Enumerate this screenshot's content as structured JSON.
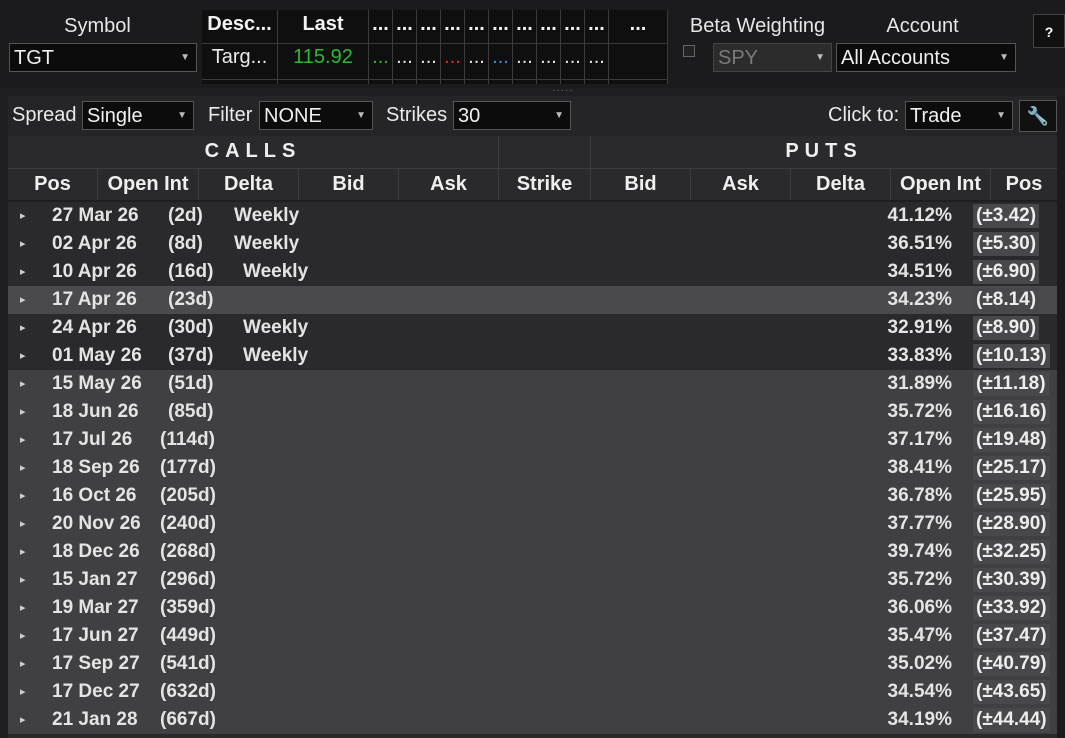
{
  "header": {
    "symbol_label": "Symbol",
    "symbol_value": "TGT",
    "beta_label": "Beta Weighting",
    "beta_value": "SPY",
    "account_label": "Account",
    "account_value": "All Accounts",
    "help": "?"
  },
  "quote": {
    "desc_head": "Desc...",
    "desc_val": "Targ...",
    "last_head": "Last",
    "last_val": "115.92",
    "small_cols": [
      {
        "head": "...",
        "val": "...",
        "color": "#2dbb2d"
      },
      {
        "head": "...",
        "val": "...",
        "color": "#e8e8e8"
      },
      {
        "head": "...",
        "val": "...",
        "color": "#e8e8e8"
      },
      {
        "head": "...",
        "val": "...",
        "color": "#d42a2a"
      },
      {
        "head": "...",
        "val": "...",
        "color": "#e8e8e8"
      },
      {
        "head": "...",
        "val": "...",
        "color": "#3a8fe0"
      },
      {
        "head": "...",
        "val": "...",
        "color": "#e8e8e8"
      },
      {
        "head": "...",
        "val": "...",
        "color": "#e8e8e8"
      },
      {
        "head": "...",
        "val": "...",
        "color": "#e8e8e8"
      },
      {
        "head": "...",
        "val": "...",
        "color": "#e8e8e8"
      },
      {
        "head": "...",
        "val": "",
        "color": "#e8e8e8"
      }
    ],
    "last_color": "#2dbb2d"
  },
  "toolbar": {
    "spread_label": "Spread",
    "spread_value": "Single",
    "filter_label": "Filter",
    "filter_value": "NONE",
    "strikes_label": "Strikes",
    "strikes_value": "30",
    "clickto_label": "Click to:",
    "clickto_value": "Trade"
  },
  "table": {
    "calls_label": "CALLS",
    "puts_label": "PUTS",
    "columns": [
      "Pos",
      "Open Int",
      "Delta",
      "Bid",
      "Ask",
      "Strike",
      "Bid",
      "Ask",
      "Delta",
      "Open Int",
      "Pos"
    ],
    "rows": [
      {
        "date": "27 Mar 26",
        "dte": "(2d)",
        "tag": "Weekly",
        "iv": "41.12%",
        "mm": "(±3.42)"
      },
      {
        "date": "02 Apr 26",
        "dte": "(8d)",
        "tag": "Weekly",
        "iv": "36.51%",
        "mm": "(±5.30)"
      },
      {
        "date": "10 Apr 26",
        "dte": "(16d)",
        "tag": "Weekly",
        "iv": "34.51%",
        "mm": "(±6.90)"
      },
      {
        "date": "17 Apr 26",
        "dte": "(23d)",
        "tag": "",
        "iv": "34.23%",
        "mm": "(±8.14)"
      },
      {
        "date": "24 Apr 26",
        "dte": "(30d)",
        "tag": "Weekly",
        "iv": "32.91%",
        "mm": "(±8.90)"
      },
      {
        "date": "01 May 26",
        "dte": "(37d)",
        "tag": "Weekly",
        "iv": "33.83%",
        "mm": "(±10.13)"
      },
      {
        "date": "15 May 26",
        "dte": "(51d)",
        "tag": "",
        "iv": "31.89%",
        "mm": "(±11.18)"
      },
      {
        "date": "18 Jun 26",
        "dte": "(85d)",
        "tag": "",
        "iv": "35.72%",
        "mm": "(±16.16)"
      },
      {
        "date": "17 Jul 26",
        "dte": "(114d)",
        "tag": "",
        "iv": "37.17%",
        "mm": "(±19.48)"
      },
      {
        "date": "18 Sep 26",
        "dte": "(177d)",
        "tag": "",
        "iv": "38.41%",
        "mm": "(±25.17)"
      },
      {
        "date": "16 Oct 26",
        "dte": "(205d)",
        "tag": "",
        "iv": "36.78%",
        "mm": "(±25.95)"
      },
      {
        "date": "20 Nov 26",
        "dte": "(240d)",
        "tag": "",
        "iv": "37.77%",
        "mm": "(±28.90)"
      },
      {
        "date": "18 Dec 26",
        "dte": "(268d)",
        "tag": "",
        "iv": "39.74%",
        "mm": "(±32.25)"
      },
      {
        "date": "15 Jan 27",
        "dte": "(296d)",
        "tag": "",
        "iv": "35.72%",
        "mm": "(±30.39)"
      },
      {
        "date": "19 Mar 27",
        "dte": "(359d)",
        "tag": "",
        "iv": "36.06%",
        "mm": "(±33.92)"
      },
      {
        "date": "17 Jun 27",
        "dte": "(449d)",
        "tag": "",
        "iv": "35.47%",
        "mm": "(±37.47)"
      },
      {
        "date": "17 Sep 27",
        "dte": "(541d)",
        "tag": "",
        "iv": "35.02%",
        "mm": "(±40.79)"
      },
      {
        "date": "17 Dec 27",
        "dte": "(632d)",
        "tag": "",
        "iv": "34.54%",
        "mm": "(±43.65)"
      },
      {
        "date": "21 Jan 28",
        "dte": "(667d)",
        "tag": "",
        "iv": "34.19%",
        "mm": "(±44.44)"
      }
    ]
  },
  "colors": {
    "weekly_row": "#2a2a2d",
    "highlight_row": "#4a4a4d",
    "monthly_row": "#404043"
  }
}
